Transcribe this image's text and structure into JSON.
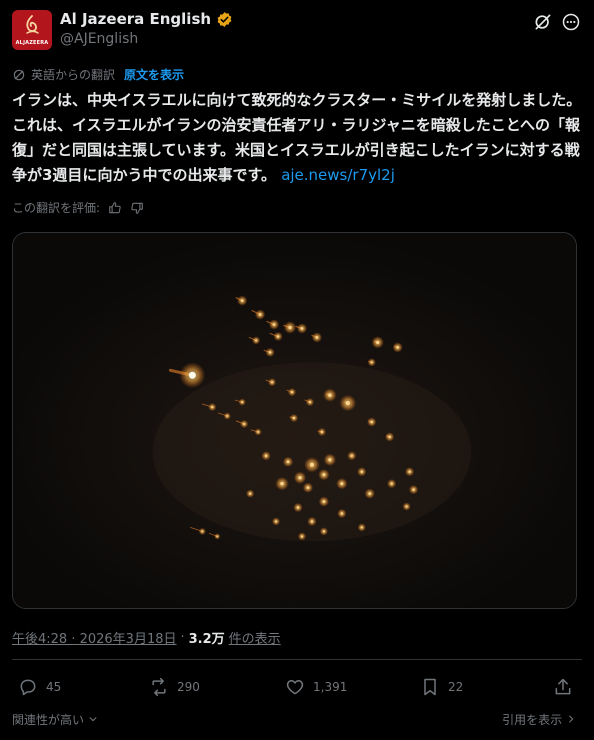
{
  "author": {
    "display_name": "Al Jazeera English",
    "handle": "@AJEnglish",
    "avatar_text": "ALJAZEERA"
  },
  "translation": {
    "note": "英語からの翻訳",
    "show_original": "原文を表示",
    "rate_label": "この翻訳を評価:"
  },
  "tweet": {
    "text": "イランは、中央イスラエルに向けて致死的なクラスター・ミサイルを発射しました。これは、イスラエルがイランの治安責任者アリ・ラリジャニを暗殺したことへの「報復」だと同国は主張しています。米国とイスラエルが引き起こしたイランに対する戦争が3週目に向かう中での出来事です。",
    "link": "aje.news/r7yl2j"
  },
  "meta": {
    "time": "午後4:28 · 2026年3月18日",
    "separator": "·",
    "views_count": "3.2万",
    "views_label": "件の表示"
  },
  "actions": {
    "replies": "45",
    "reposts": "290",
    "likes": "1,391",
    "bookmarks": "22"
  },
  "footer": {
    "relevance": "関連性が高い",
    "quotes": "引用を表示"
  },
  "colors": {
    "accent": "#1d9bf0",
    "verified": "#e8a417",
    "avatar_bg": "#b3151d"
  },
  "icons": [
    "grok-icon",
    "more-icon",
    "translate-icon",
    "thumbs-up-icon",
    "thumbs-down-icon",
    "reply-icon",
    "repost-icon",
    "like-icon",
    "bookmark-icon",
    "share-icon",
    "chevron-down-icon",
    "chevron-right-icon",
    "verified-badge-icon"
  ]
}
